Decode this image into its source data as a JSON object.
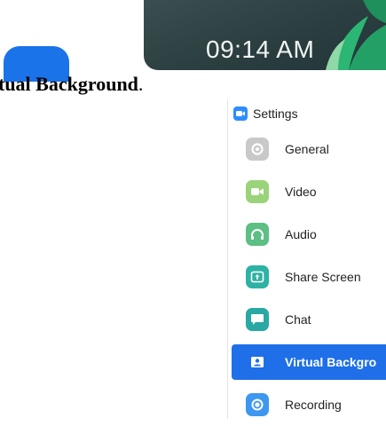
{
  "clock": {
    "time": "09:14 AM"
  },
  "caption": {
    "bold_text": "tual Background",
    "suffix": "."
  },
  "settings": {
    "title": "Settings",
    "items": [
      {
        "label": "General",
        "icon": "gear-icon",
        "color": "#c9c9c9"
      },
      {
        "label": "Video",
        "icon": "video-camera-icon",
        "color": "#9bd37a"
      },
      {
        "label": "Audio",
        "icon": "headphones-icon",
        "color": "#5cbf83"
      },
      {
        "label": "Share Screen",
        "icon": "share-screen-icon",
        "color": "#2db2a4"
      },
      {
        "label": "Chat",
        "icon": "chat-bubble-icon",
        "color": "#2aa8a4"
      },
      {
        "label": "Virtual Backgro",
        "icon": "virtual-background-icon",
        "color": "#1e6fe8",
        "active": true
      },
      {
        "label": "Recording",
        "icon": "recording-icon",
        "color": "#3d97f0"
      }
    ]
  },
  "colors": {
    "accent": "#1e6fe8",
    "banner": "#2b3e40"
  }
}
